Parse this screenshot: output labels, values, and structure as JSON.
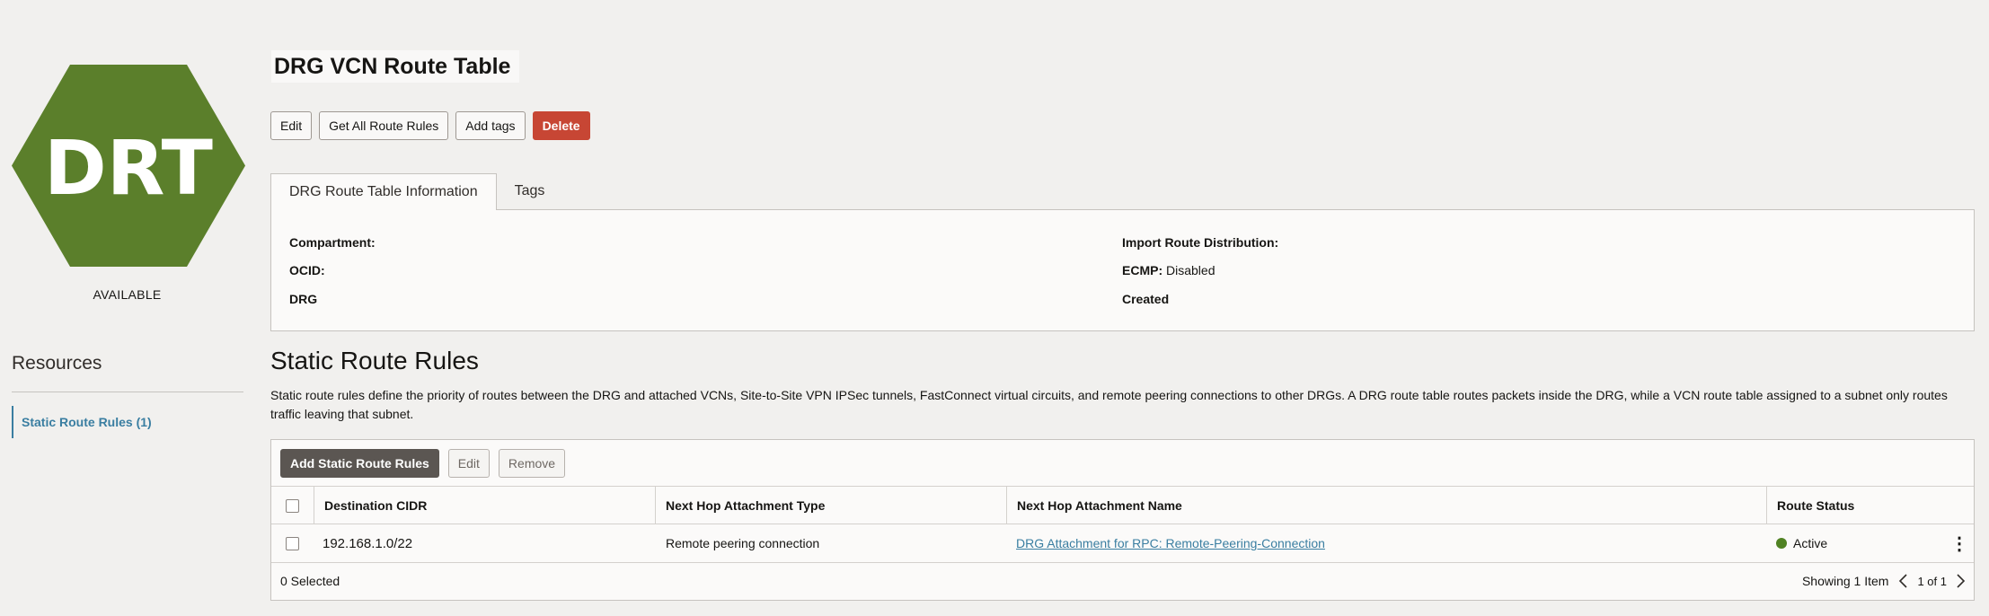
{
  "resource": {
    "badge_text": "DRT",
    "badge_color": "#5b7f2b",
    "status": "AVAILABLE"
  },
  "resources_nav": {
    "title": "Resources",
    "items": [
      {
        "label": "Static Route Rules (1)"
      }
    ]
  },
  "page": {
    "title": "DRG VCN Route Table"
  },
  "actions": {
    "edit": "Edit",
    "get_all_route_rules": "Get All Route Rules",
    "add_tags": "Add tags",
    "delete": "Delete"
  },
  "tabs": [
    {
      "label": "DRG Route Table Information",
      "active": true
    },
    {
      "label": "Tags",
      "active": false
    }
  ],
  "info": {
    "compartment_label": "Compartment:",
    "compartment_value": "",
    "ocid_label": "OCID:",
    "ocid_value": "",
    "drg_label": "DRG",
    "drg_value": "",
    "import_route_distribution_label": "Import Route Distribution:",
    "import_route_distribution_value": "",
    "ecmp_label": "ECMP:",
    "ecmp_value": "Disabled",
    "created_label": "Created",
    "created_value": ""
  },
  "static_route_rules": {
    "title": "Static Route Rules",
    "description": "Static route rules define the priority of routes between the DRG and attached VCNs, Site-to-Site VPN IPSec tunnels, FastConnect virtual circuits, and remote peering connections to other DRGs. A DRG route table routes packets inside the DRG, while a VCN route table assigned to a subnet only routes traffic leaving that subnet.",
    "toolbar": {
      "add": "Add Static Route Rules",
      "edit": "Edit",
      "remove": "Remove"
    },
    "columns": [
      "Destination CIDR",
      "Next Hop Attachment Type",
      "Next Hop Attachment Name",
      "Route Status"
    ],
    "rows": [
      {
        "destination_cidr": "192.168.1.0/22",
        "next_hop_type": "Remote peering connection",
        "next_hop_name": "DRG Attachment for RPC: Remote-Peering-Connection",
        "route_status": "Active",
        "status_color": "#508223"
      }
    ],
    "selected_count": "0 Selected",
    "showing": "Showing 1 Item",
    "page_indicator": "1 of 1"
  }
}
